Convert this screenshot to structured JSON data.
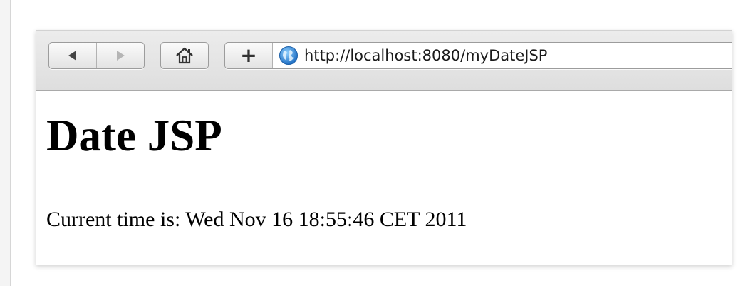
{
  "toolbar": {
    "back_icon": "back-arrow-icon",
    "forward_icon": "forward-arrow-icon",
    "home_icon": "home-icon",
    "add_label": "+",
    "site_icon": "globe-icon",
    "url": "http://localhost:8080/myDateJSP"
  },
  "page": {
    "heading": "Date JSP",
    "time_text": "Current time is: Wed Nov 16 18:55:46 CET 2011"
  },
  "colors": {
    "toolbar_bg": "#e5e5e5",
    "globe": "#2a7fd4"
  }
}
